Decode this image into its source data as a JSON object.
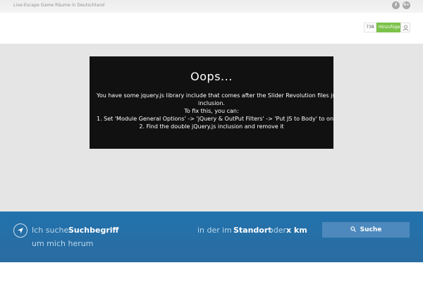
{
  "topbar": {
    "tagline": "Live-Escape Game Räume in Deutschland",
    "social": [
      {
        "icon": "facebook-icon",
        "glyph": "f"
      },
      {
        "icon": "google-plus-icon",
        "glyph": "G+"
      }
    ]
  },
  "header": {
    "count": "738",
    "add_label": "Hinzufügen",
    "user_icon": "user-icon",
    "accent": "#7cc24a"
  },
  "error": {
    "title": "Oops...",
    "lines": [
      "You have some jquery.js library include that comes after the Slider Revolution files js",
      "inclusion.",
      "To fix this, you can:",
      "1. Set 'Module General Options' -> 'jQuery & OutPut Filters' -> 'Put JS to Body' to on",
      "2. Find the double jQuery.js inclusion and remove it"
    ]
  },
  "search": {
    "location_icon": "location-arrow-icon",
    "prefix": "Ich suche",
    "term": "Suchbegriff",
    "near_me": "um mich herum",
    "in_der": "in der",
    "im": "im",
    "place": "Standort",
    "oder": "oder",
    "radius": "x km",
    "button_label": "Suche",
    "button_icon": "search-icon",
    "color": "#2272ad"
  }
}
